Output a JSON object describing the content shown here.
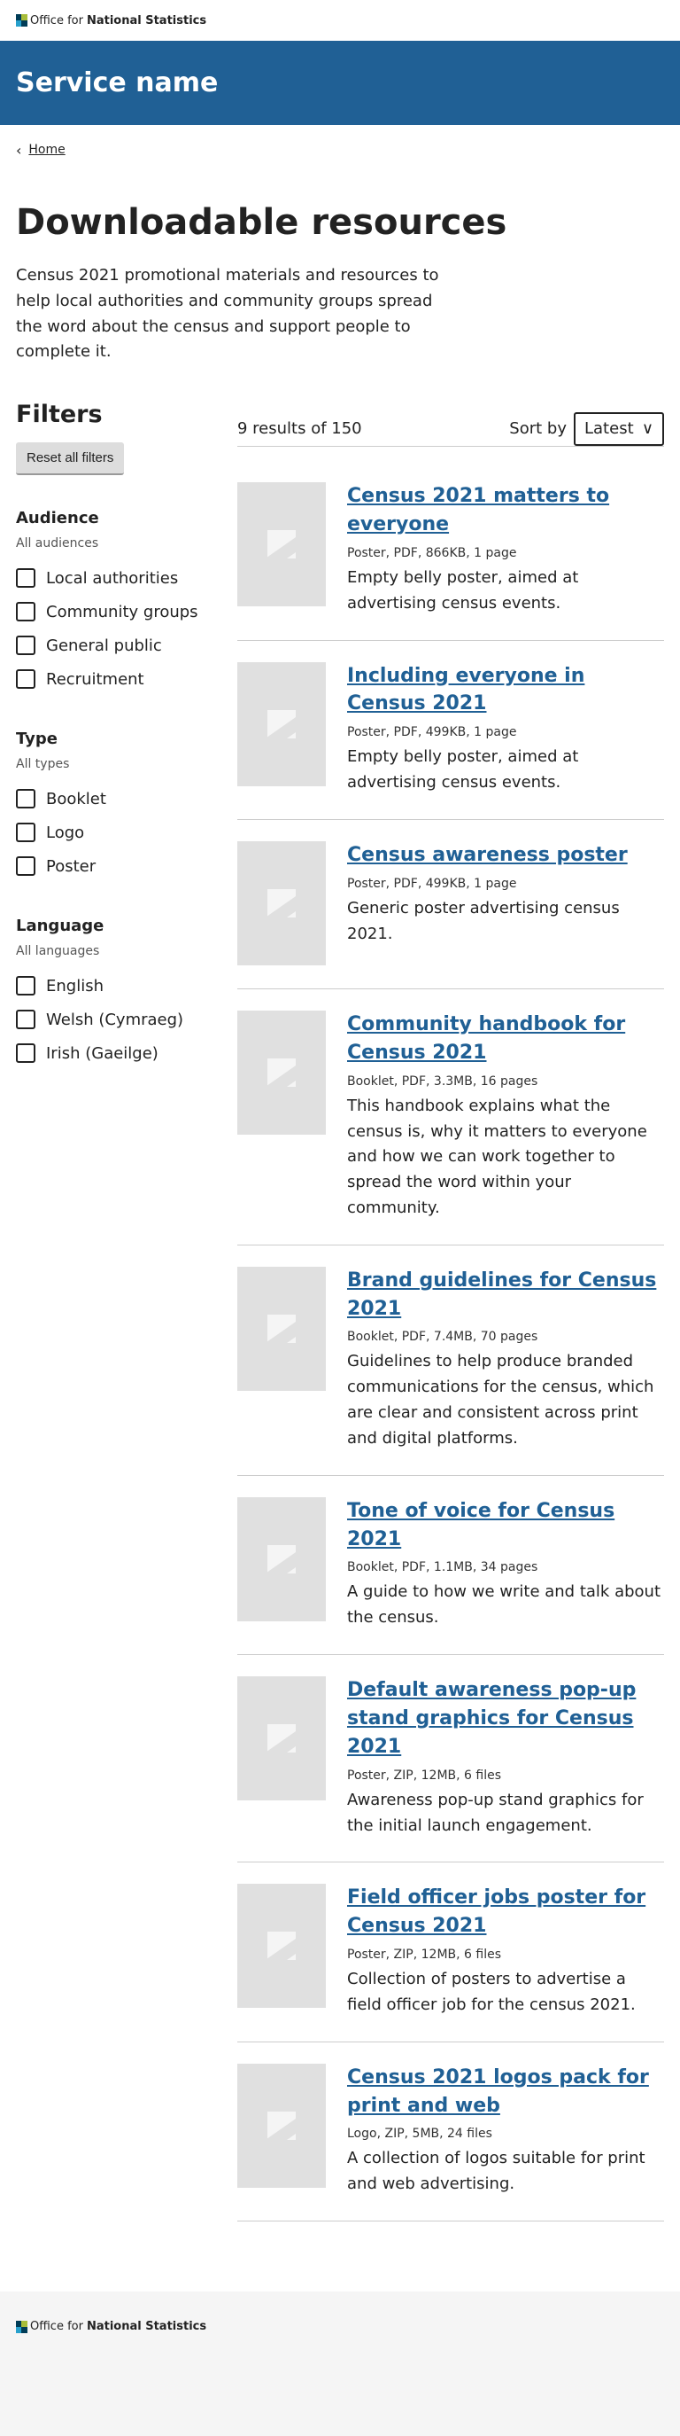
{
  "brand": {
    "logo_prefix": "Office for",
    "logo_strong": "National Statistics"
  },
  "header": {
    "service_name": "Service name"
  },
  "breadcrumb": {
    "home": "Home"
  },
  "page": {
    "title": "Downloadable resources",
    "intro": "Census 2021 promotional materials and resources to help local authorities and community groups spread the word about the census and support people to complete it."
  },
  "filters": {
    "heading": "Filters",
    "reset_label": "Reset all filters",
    "groups": [
      {
        "title": "Audience",
        "all_label": "All audiences",
        "options": [
          "Local authorities",
          "Community groups",
          "General public",
          "Recruitment"
        ]
      },
      {
        "title": "Type",
        "all_label": "All types",
        "options": [
          "Booklet",
          "Logo",
          "Poster"
        ]
      },
      {
        "title": "Language",
        "all_label": "All languages",
        "options": [
          "English",
          "Welsh (Cymraeg)",
          "Irish (Gaeilge)"
        ]
      }
    ]
  },
  "results_bar": {
    "count": "9 results of 150",
    "sort_label": "Sort by",
    "sort_value": "Latest"
  },
  "results": [
    {
      "title": "Census 2021 matters to everyone",
      "meta": "Poster, PDF, 866KB, 1 page",
      "description": "Empty belly poster, aimed at advertising census events."
    },
    {
      "title": "Including everyone in Census 2021",
      "meta": "Poster, PDF, 499KB, 1 page",
      "description": "Empty belly poster, aimed at advertising census events."
    },
    {
      "title": "Census awareness poster",
      "meta": "Poster, PDF, 499KB, 1 page",
      "description": "Generic poster advertising census 2021."
    },
    {
      "title": "Community handbook for Census 2021",
      "meta": "Booklet, PDF, 3.3MB, 16 pages",
      "description": "This handbook explains what the census is, why it matters to everyone and how we can work together to spread the word within your community."
    },
    {
      "title": "Brand guidelines for Census 2021",
      "meta": "Booklet, PDF, 7.4MB, 70 pages",
      "description": "Guidelines to help produce branded communications for the census, which are clear and consistent across print and digital platforms."
    },
    {
      "title": "Tone of voice for Census 2021",
      "meta": "Booklet, PDF, 1.1MB, 34 pages",
      "description": "A guide to how we write and talk about the census."
    },
    {
      "title": "Default awareness pop-up stand graphics for Census 2021",
      "meta": "Poster, ZIP, 12MB, 6 files",
      "description": "Awareness pop-up stand graphics for the initial launch engagement."
    },
    {
      "title": "Field officer jobs poster for Census 2021",
      "meta": "Poster, ZIP, 12MB, 6 files",
      "description": "Collection of posters to advertise a field officer job for the census 2021."
    },
    {
      "title": "Census 2021 logos pack for print and web",
      "meta": "Logo, ZIP, 5MB, 24 files",
      "description": "A collection of logos suitable for print and web advertising."
    }
  ],
  "colors": {
    "brand_blue": "#206095",
    "footer_bg": "#f5f5f5",
    "thumb_bg": "#e0e0e0"
  }
}
